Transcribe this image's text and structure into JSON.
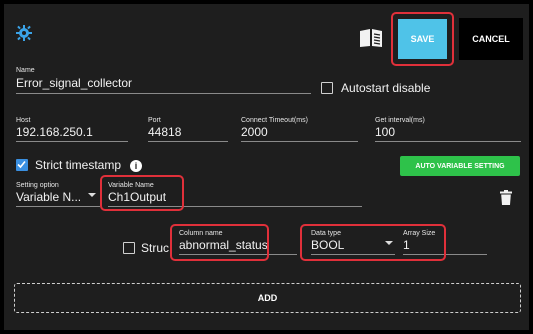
{
  "toolbar": {
    "save_label": "SAVE",
    "cancel_label": "CANCEL",
    "icons": {
      "app": "bug-gear-icon",
      "manual": "open-book-icon"
    },
    "save_color": "#4fc3e8"
  },
  "form": {
    "name": {
      "label": "Name",
      "value": "Error_signal_collector"
    },
    "autostart": {
      "label": "Autostart disable",
      "checked": false
    },
    "host": {
      "label": "Host",
      "value": "192.168.250.1"
    },
    "port": {
      "label": "Port",
      "value": "44818"
    },
    "connect_timeout": {
      "label": "Connect Timeout(ms)",
      "value": "2000"
    },
    "get_interval": {
      "label": "Get interval(ms)",
      "value": "100"
    },
    "strict_timestamp": {
      "label": "Strict timestamp",
      "checked": true,
      "info_icon": "i"
    },
    "auto_variable_button": {
      "label": "AUTO VARIABLE SETTING",
      "color": "#2ec24a"
    },
    "setting_option": {
      "label": "Setting option",
      "value": "Variable N..."
    },
    "variable_name": {
      "label": "Variable Name",
      "value": "Ch1Output"
    },
    "structure": {
      "label": "Struc",
      "checked": false
    },
    "column_name": {
      "label": "Column name",
      "value": "abnormal_status"
    },
    "data_type": {
      "label": "Data type",
      "value": "BOOL"
    },
    "array_size": {
      "label": "Array Size",
      "value": "1"
    },
    "add_button": {
      "label": "ADD"
    }
  },
  "highlight_color": "#e0303a"
}
